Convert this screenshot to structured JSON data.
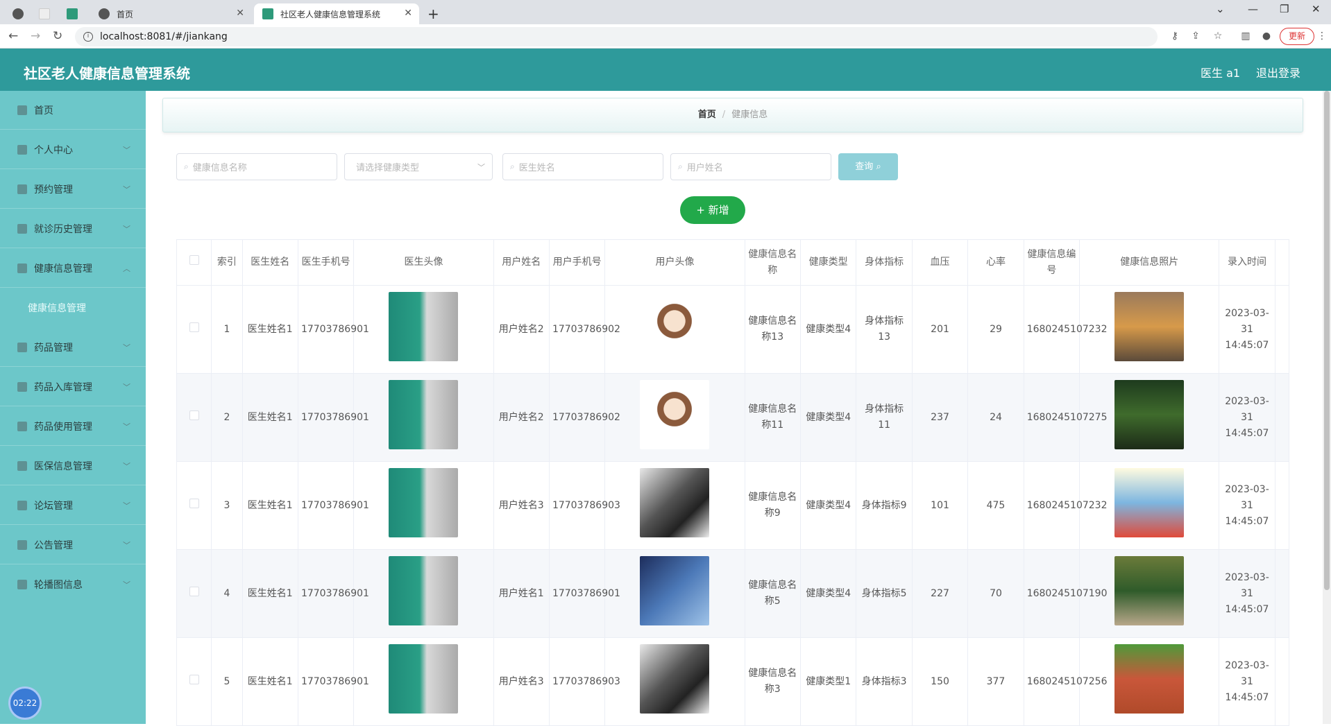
{
  "browser": {
    "tabs": [
      {
        "label": "首页"
      },
      {
        "label": "社区老人健康信息管理系统"
      }
    ],
    "url": "localhost:8081/#/jiankang",
    "update_label": "更新"
  },
  "header": {
    "title": "社区老人健康信息管理系统",
    "user": "医生 a1",
    "logout": "退出登录"
  },
  "sidebar": {
    "items": [
      {
        "label": "首页"
      },
      {
        "label": "个人中心"
      },
      {
        "label": "预约管理"
      },
      {
        "label": "就诊历史管理"
      },
      {
        "label": "健康信息管理"
      },
      {
        "label": "健康信息管理"
      },
      {
        "label": "药品管理"
      },
      {
        "label": "药品入库管理"
      },
      {
        "label": "药品使用管理"
      },
      {
        "label": "医保信息管理"
      },
      {
        "label": "论坛管理"
      },
      {
        "label": "公告管理"
      },
      {
        "label": "轮播图信息"
      }
    ],
    "clock": "02:22"
  },
  "breadcrumb": {
    "home": "首页",
    "current": "健康信息"
  },
  "search": {
    "name_placeholder": "健康信息名称",
    "type_placeholder": "请选择健康类型",
    "doctor_placeholder": "医生姓名",
    "user_placeholder": "用户姓名",
    "query_label": "查询",
    "add_label": "+ 新增"
  },
  "table": {
    "headers": [
      "索引",
      "医生姓名",
      "医生手机号",
      "医生头像",
      "用户姓名",
      "用户手机号",
      "用户头像",
      "健康信息名称",
      "健康类型",
      "身体指标",
      "血压",
      "心率",
      "健康信息编号",
      "健康信息照片",
      "录入时间"
    ],
    "rows": [
      {
        "index": "1",
        "doctor": "医生姓名1",
        "doctor_phone": "17703786901",
        "user": "用户姓名2",
        "user_phone": "17703786902",
        "name": "健康信息名称13",
        "type": "健康类型4",
        "indicator": "身体指标13",
        "bp": "201",
        "hr": "29",
        "code": "1680245107232",
        "time": "2023-03-31 14:45:07"
      },
      {
        "index": "2",
        "doctor": "医生姓名1",
        "doctor_phone": "17703786901",
        "user": "用户姓名2",
        "user_phone": "17703786902",
        "name": "健康信息名称11",
        "type": "健康类型4",
        "indicator": "身体指标11",
        "bp": "237",
        "hr": "24",
        "code": "1680245107275",
        "time": "2023-03-31 14:45:07"
      },
      {
        "index": "3",
        "doctor": "医生姓名1",
        "doctor_phone": "17703786901",
        "user": "用户姓名3",
        "user_phone": "17703786903",
        "name": "健康信息名称9",
        "type": "健康类型4",
        "indicator": "身体指标9",
        "bp": "101",
        "hr": "475",
        "code": "1680245107232",
        "time": "2023-03-31 14:45:07"
      },
      {
        "index": "4",
        "doctor": "医生姓名1",
        "doctor_phone": "17703786901",
        "user": "用户姓名1",
        "user_phone": "17703786901",
        "name": "健康信息名称5",
        "type": "健康类型4",
        "indicator": "身体指标5",
        "bp": "227",
        "hr": "70",
        "code": "1680245107190",
        "time": "2023-03-31 14:45:07"
      },
      {
        "index": "5",
        "doctor": "医生姓名1",
        "doctor_phone": "17703786901",
        "user": "用户姓名3",
        "user_phone": "17703786903",
        "name": "健康信息名称3",
        "type": "健康类型1",
        "indicator": "身体指标3",
        "bp": "150",
        "hr": "377",
        "code": "1680245107256",
        "time": "2023-03-31 14:45:07"
      }
    ]
  }
}
